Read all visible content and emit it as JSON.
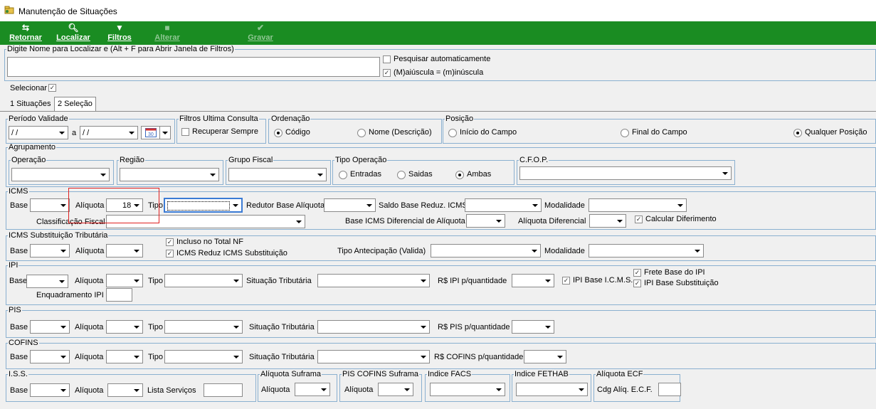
{
  "window": {
    "title": "Manutenção de Situações"
  },
  "toolbar": {
    "retornar": "Retornar",
    "localizar": "Localizar",
    "filtros": "Filtros",
    "alterar": "Alterar",
    "gravar": "Gravar"
  },
  "search": {
    "legend": "Digite Nome para Localizar e (Alt + F para Abrir Janela de Filtros)",
    "value": "",
    "auto_label": "Pesquisar automaticamente",
    "case_label": "(M)aiúscula = (m)inúscula"
  },
  "selecionar": "Selecionar",
  "tabs": [
    "1 Situações",
    "2 Seleção"
  ],
  "periodo": {
    "legend": "Período Validade",
    "from": " / /",
    "sep": "a",
    "to": " / /"
  },
  "filtros_ultima": {
    "legend": "Filtros Ultima Consulta",
    "recuperar": "Recuperar Sempre"
  },
  "ordenacao": {
    "legend": "Ordenação",
    "codigo": "Código",
    "nome": "Nome (Descrição)"
  },
  "posicao": {
    "legend": "Posição",
    "inicio": "Início do Campo",
    "final": "Final do Campo",
    "qualquer": "Qualquer Posição"
  },
  "agrupamento": {
    "legend": "Agrupamento",
    "operacao": "Operação",
    "regiao": "Região",
    "grupo_fiscal": "Grupo Fiscal",
    "tipo_operacao": "Tipo Operação",
    "entradas": "Entradas",
    "saidas": "Saidas",
    "ambas": "Ambas",
    "cfop": "C.F.O.P."
  },
  "icms": {
    "legend": "ICMS",
    "base": "Base",
    "aliquota": "Alíquota",
    "aliquota_value": "18",
    "tipo": "Tipo",
    "redutor": "Redutor Base Alíquota",
    "saldo": "Saldo Base Reduz. ICMS",
    "modalidade": "Modalidade",
    "classificacao": "Classificação Fiscal",
    "base_dif": "Base ICMS Diferencial de Alíquota",
    "aliq_dif": "Alíquota Diferencial",
    "calcular": "Calcular Diferimento"
  },
  "icms_st": {
    "legend": "ICMS Substituição Tributária",
    "base": "Base",
    "aliquota": "Alíquota",
    "incluso": "Incluso no Total NF",
    "reduz": "ICMS Reduz ICMS Substituição",
    "tipo_antecipacao": "Tipo Antecipação (Valida)",
    "modalidade": "Modalidade"
  },
  "ipi": {
    "legend": "IPI",
    "base": "Base",
    "aliquota": "Alíquota",
    "tipo": "Tipo",
    "situacao": "Situação Tributária",
    "rs": "R$ IPI p/quantidade",
    "ipi_base_icms": "IPI Base I.C.M.S.",
    "frete": "Frete Base do IPI",
    "ipi_base_sub": "IPI Base Substituição",
    "enquadramento": "Enquadramento IPI"
  },
  "pis": {
    "legend": "PIS",
    "base": "Base",
    "aliquota": "Alíquota",
    "tipo": "Tipo",
    "situacao": "Situação Tributária",
    "rs": "R$ PIS p/quantidade"
  },
  "cofins": {
    "legend": "COFINS",
    "base": "Base",
    "aliquota": "Alíquota",
    "tipo": "Tipo",
    "situacao": "Situação Tributária",
    "rs": "R$ COFINS p/quantidade"
  },
  "iss": {
    "legend": "I.S.S.",
    "base": "Base",
    "aliquota": "Alíquota",
    "lista": "Lista Serviços"
  },
  "suframa": {
    "legend": "Alíquota Suframa",
    "aliquota": "Alíquota"
  },
  "pis_cofins_suframa": {
    "legend": "PIS COFINS Suframa",
    "aliquota": "Alíquota"
  },
  "facs": {
    "legend": "Indice FACS"
  },
  "fethab": {
    "legend": "Indice FETHAB"
  },
  "ecf": {
    "legend": "Alíquota ECF",
    "cdg": "Cdg Alíq. E.C.F."
  },
  "colors": {
    "toolbar": "#1a8c22",
    "border": "#8ab0d0",
    "highlight": "#e02020",
    "focus": "#3b7bd4"
  }
}
